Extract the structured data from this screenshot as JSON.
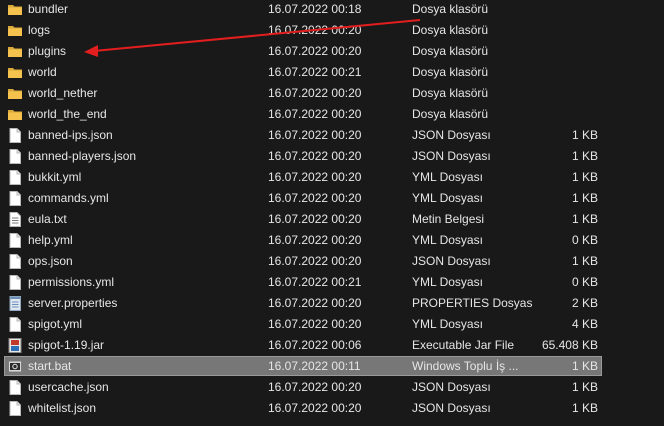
{
  "files": [
    {
      "name": "bundler",
      "date": "16.07.2022 00:18",
      "type": "Dosya klasörü",
      "size": "",
      "icon": "folder-icon",
      "selected": false
    },
    {
      "name": "logs",
      "date": "16.07.2022 00:20",
      "type": "Dosya klasörü",
      "size": "",
      "icon": "folder-icon",
      "selected": false
    },
    {
      "name": "plugins",
      "date": "16.07.2022 00:20",
      "type": "Dosya klasörü",
      "size": "",
      "icon": "folder-icon",
      "selected": false
    },
    {
      "name": "world",
      "date": "16.07.2022 00:21",
      "type": "Dosya klasörü",
      "size": "",
      "icon": "folder-icon",
      "selected": false
    },
    {
      "name": "world_nether",
      "date": "16.07.2022 00:20",
      "type": "Dosya klasörü",
      "size": "",
      "icon": "folder-icon",
      "selected": false
    },
    {
      "name": "world_the_end",
      "date": "16.07.2022 00:20",
      "type": "Dosya klasörü",
      "size": "",
      "icon": "folder-icon",
      "selected": false
    },
    {
      "name": "banned-ips.json",
      "date": "16.07.2022 00:20",
      "type": "JSON Dosyası",
      "size": "1 KB",
      "icon": "file-icon",
      "selected": false
    },
    {
      "name": "banned-players.json",
      "date": "16.07.2022 00:20",
      "type": "JSON Dosyası",
      "size": "1 KB",
      "icon": "file-icon",
      "selected": false
    },
    {
      "name": "bukkit.yml",
      "date": "16.07.2022 00:20",
      "type": "YML Dosyası",
      "size": "1 KB",
      "icon": "file-icon",
      "selected": false
    },
    {
      "name": "commands.yml",
      "date": "16.07.2022 00:20",
      "type": "YML Dosyası",
      "size": "1 KB",
      "icon": "file-icon",
      "selected": false
    },
    {
      "name": "eula.txt",
      "date": "16.07.2022 00:20",
      "type": "Metin Belgesi",
      "size": "1 KB",
      "icon": "text-file-icon",
      "selected": false
    },
    {
      "name": "help.yml",
      "date": "16.07.2022 00:20",
      "type": "YML Dosyası",
      "size": "0 KB",
      "icon": "file-icon",
      "selected": false
    },
    {
      "name": "ops.json",
      "date": "16.07.2022 00:20",
      "type": "JSON Dosyası",
      "size": "1 KB",
      "icon": "file-icon",
      "selected": false
    },
    {
      "name": "permissions.yml",
      "date": "16.07.2022 00:21",
      "type": "YML Dosyası",
      "size": "0 KB",
      "icon": "file-icon",
      "selected": false
    },
    {
      "name": "server.properties",
      "date": "16.07.2022 00:20",
      "type": "PROPERTIES Dosyası",
      "size": "2 KB",
      "icon": "properties-file-icon",
      "selected": false
    },
    {
      "name": "spigot.yml",
      "date": "16.07.2022 00:20",
      "type": "YML Dosyası",
      "size": "4 KB",
      "icon": "file-icon",
      "selected": false
    },
    {
      "name": "spigot-1.19.jar",
      "date": "16.07.2022 00:06",
      "type": "Executable Jar File",
      "size": "65.408 KB",
      "icon": "jar-file-icon",
      "selected": false
    },
    {
      "name": "start.bat",
      "date": "16.07.2022 00:11",
      "type": "Windows Toplu İş ...",
      "size": "1 KB",
      "icon": "batch-file-icon",
      "selected": true
    },
    {
      "name": "usercache.json",
      "date": "16.07.2022 00:20",
      "type": "JSON Dosyası",
      "size": "1 KB",
      "icon": "file-icon",
      "selected": false
    },
    {
      "name": "whitelist.json",
      "date": "16.07.2022 00:20",
      "type": "JSON Dosyası",
      "size": "1 KB",
      "icon": "file-icon",
      "selected": false
    }
  ],
  "colors": {
    "background": "#191919",
    "text": "#e6e6e6",
    "selection": "#777777",
    "folder": "#f4c24d",
    "annotation_arrow": "#e31e1e"
  },
  "annotation": {
    "type": "arrow",
    "color": "#e31e1e",
    "points_to": "plugins"
  }
}
